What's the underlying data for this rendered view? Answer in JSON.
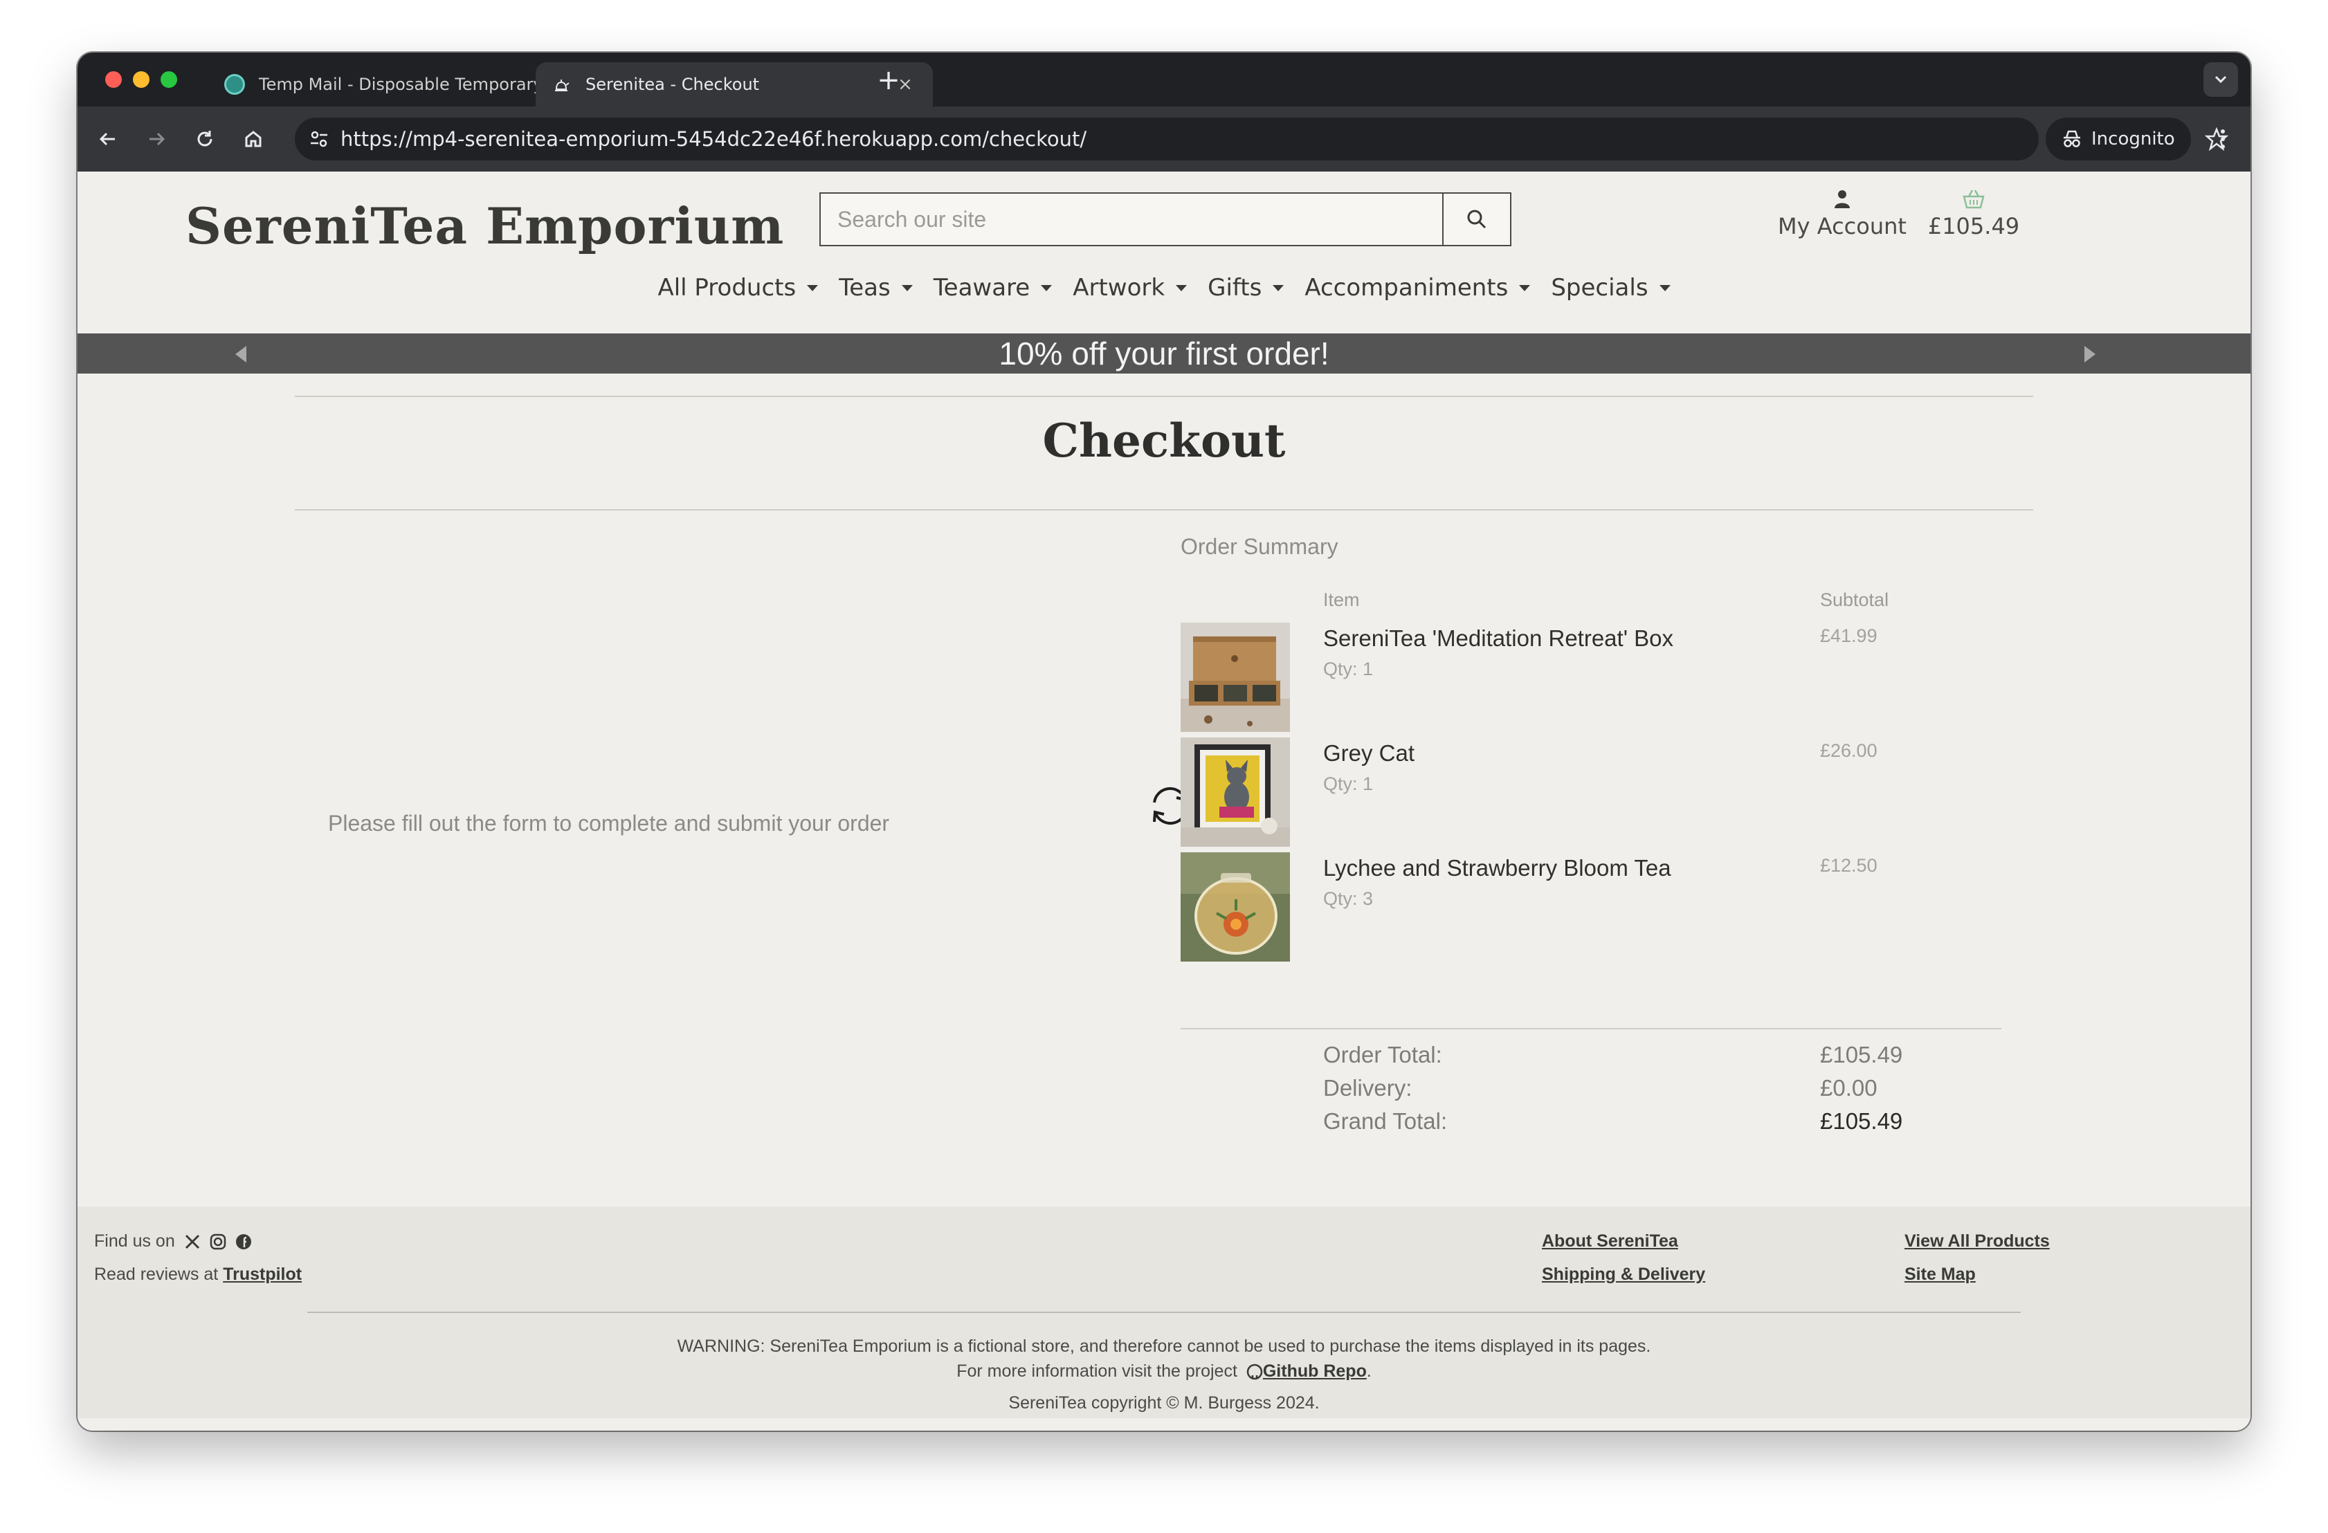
{
  "browser": {
    "tabs": [
      {
        "title": "Temp Mail - Disposable Temporary Email",
        "active": false
      },
      {
        "title": "Serenitea - Checkout",
        "active": true
      }
    ],
    "url": "https://mp4-serenitea-emporium-5454dc22e46f.herokuapp.com/checkout/",
    "incognito_label": "Incognito",
    "tab_close_glyph": "×",
    "new_tab_glyph": "+"
  },
  "header": {
    "logo": "SereniTea Emporium",
    "search_placeholder": "Search our site",
    "account_label": "My Account",
    "basket_total": "£105.49"
  },
  "nav": {
    "items": [
      "All Products",
      "Teas",
      "Teaware",
      "Artwork",
      "Gifts",
      "Accompaniments",
      "Specials"
    ]
  },
  "banner": {
    "text": "10% off your first order!"
  },
  "checkout": {
    "title": "Checkout",
    "form_message": "Please fill out the form to complete and submit your order",
    "summary_title": "Order Summary",
    "col_item": "Item",
    "col_subtotal": "Subtotal",
    "items": [
      {
        "name": "SereniTea 'Meditation Retreat' Box",
        "qty": "Qty: 1",
        "subtotal": "£41.99"
      },
      {
        "name": "Grey Cat",
        "qty": "Qty: 1",
        "subtotal": "£26.00"
      },
      {
        "name": "Lychee and Strawberry Bloom Tea",
        "qty": "Qty: 3",
        "subtotal": "£12.50"
      }
    ],
    "totals": [
      {
        "label": "Order Total:",
        "value": "£105.49"
      },
      {
        "label": "Delivery:",
        "value": "£0.00"
      },
      {
        "label": "Grand Total:",
        "value": "£105.49"
      }
    ]
  },
  "footer": {
    "find_us": "Find us on",
    "reviews_prefix": "Read reviews at",
    "trustpilot": "Trustpilot",
    "links": [
      "About SereniTea",
      "Shipping & Delivery",
      "View All Products",
      "Site Map"
    ],
    "warning": "WARNING: SereniTea Emporium is a fictional store, and therefore cannot be used to purchase the items displayed in its pages.",
    "more_info_prefix": "For more information visit the project",
    "repo_link": "Github Repo",
    "copyright": "SereniTea copyright © M. Burgess 2024."
  },
  "colors": {
    "page_bg": "#f0efeb",
    "banner_bg": "#545454",
    "footer_bg": "#e6e5e0",
    "tabbar_bg": "#202124",
    "toolbar_bg": "#35363a"
  }
}
